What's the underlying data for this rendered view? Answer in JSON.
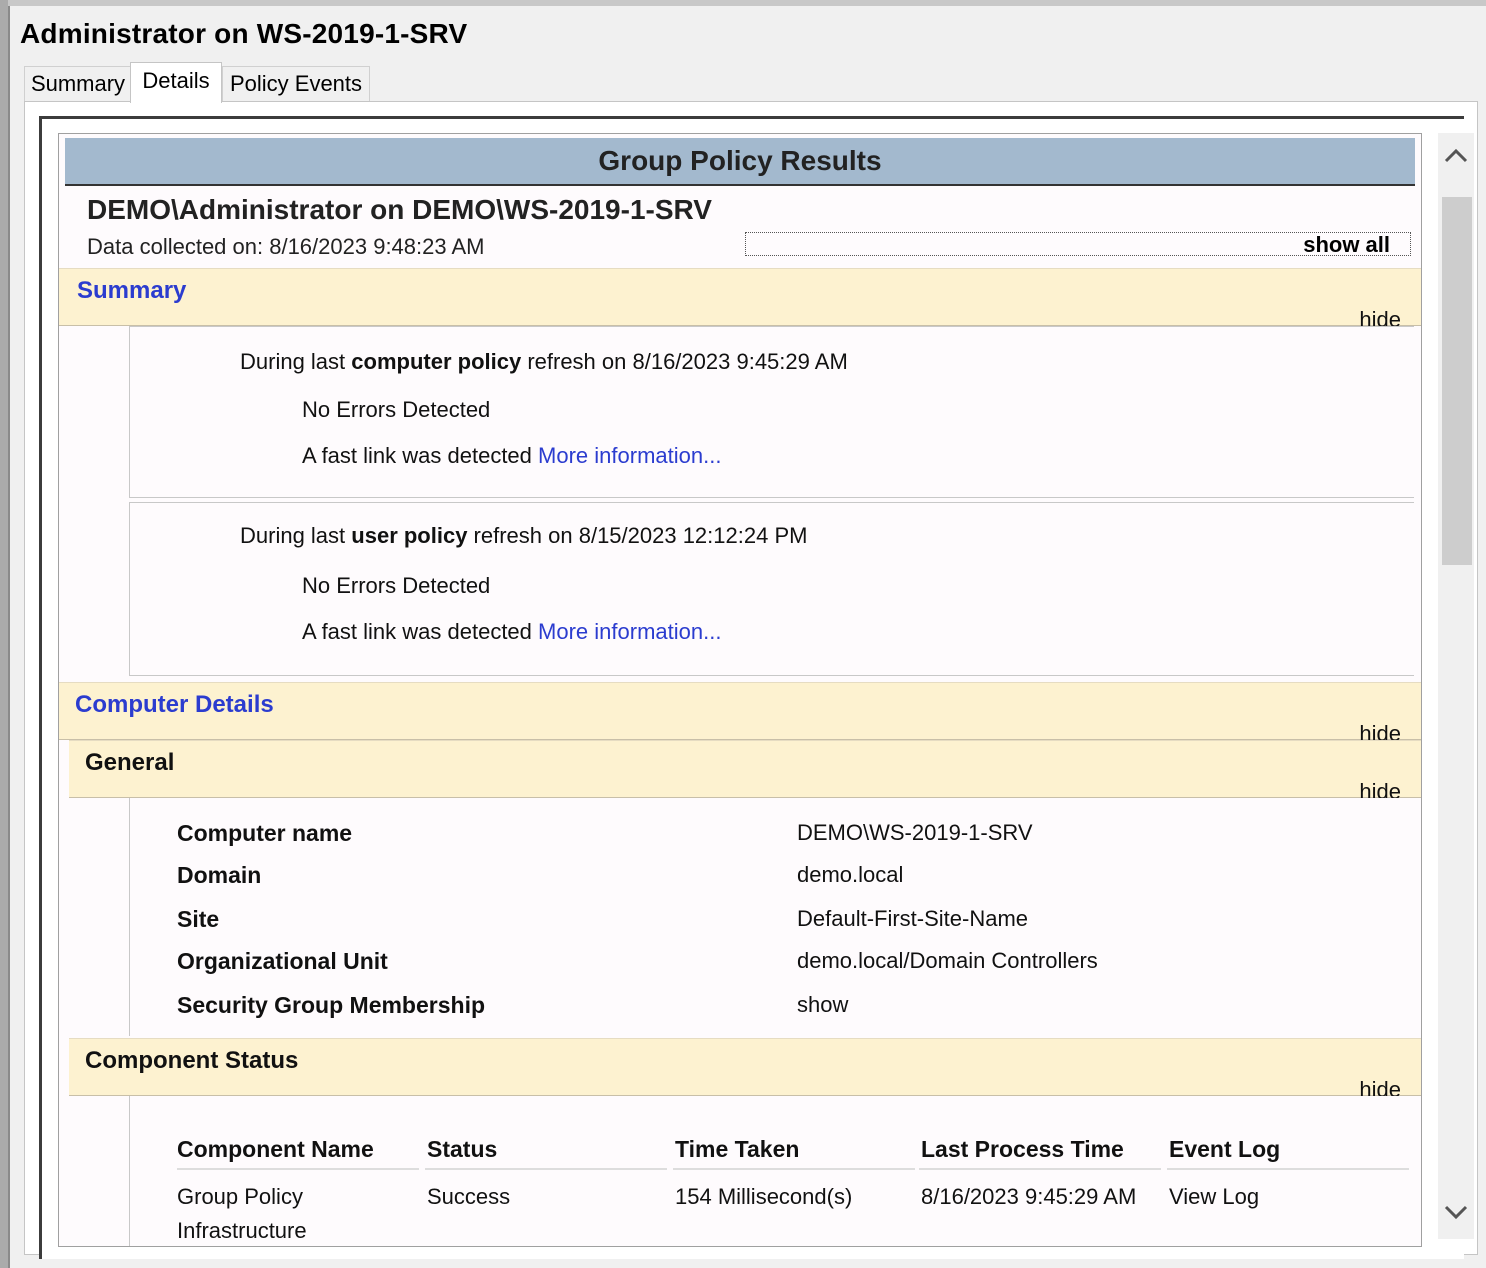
{
  "window": {
    "title": "Administrator on WS-2019-1-SRV"
  },
  "tabs": [
    {
      "label": "Summary"
    },
    {
      "label": "Details"
    },
    {
      "label": "Policy Events"
    }
  ],
  "report": {
    "title": "Group Policy Results",
    "subject": "DEMO\\Administrator on DEMO\\WS-2019-1-SRV",
    "collected": "Data collected on: 8/16/2023 9:48:23 AM",
    "show_all": "show all",
    "hide_label": "hide",
    "summary": {
      "title": "Summary",
      "computer": {
        "prefix": "During last ",
        "bold": "computer policy",
        "suffix": " refresh on 8/16/2023 9:45:29 AM",
        "errors": "No Errors Detected",
        "fast_link": "A fast link was detected ",
        "more_info": "More information..."
      },
      "user": {
        "prefix": "During last ",
        "bold": "user policy",
        "suffix": " refresh on 8/15/2023 12:12:24 PM",
        "errors": "No Errors Detected",
        "fast_link": "A fast link was detected ",
        "more_info": "More information..."
      }
    },
    "computer_details": {
      "title": "Computer Details",
      "general": {
        "title": "General",
        "rows": [
          {
            "label": "Computer name",
            "value": "DEMO\\WS-2019-1-SRV"
          },
          {
            "label": "Domain",
            "value": "demo.local"
          },
          {
            "label": "Site",
            "value": "Default-First-Site-Name"
          },
          {
            "label": "Organizational Unit",
            "value": "demo.local/Domain Controllers"
          },
          {
            "label": "Security Group Membership",
            "value": "show"
          }
        ]
      },
      "component_status": {
        "title": "Component Status",
        "headers": [
          "Component Name",
          "Status",
          "Time Taken",
          "Last Process Time",
          "Event Log"
        ],
        "rows": [
          {
            "name_line1": "Group Policy",
            "name_line2": "Infrastructure",
            "status": "Success",
            "time_taken": "154 Millisecond(s)",
            "last_process": "8/16/2023 9:45:29 AM",
            "event_log": "View Log"
          }
        ]
      }
    }
  },
  "colors": {
    "header_bg": "#a3b9ce",
    "section_bg": "#fdf2d0",
    "link": "#2b3ccf"
  },
  "icons": {
    "scroll_up": "chevron-up-icon",
    "scroll_down": "chevron-down-icon"
  }
}
